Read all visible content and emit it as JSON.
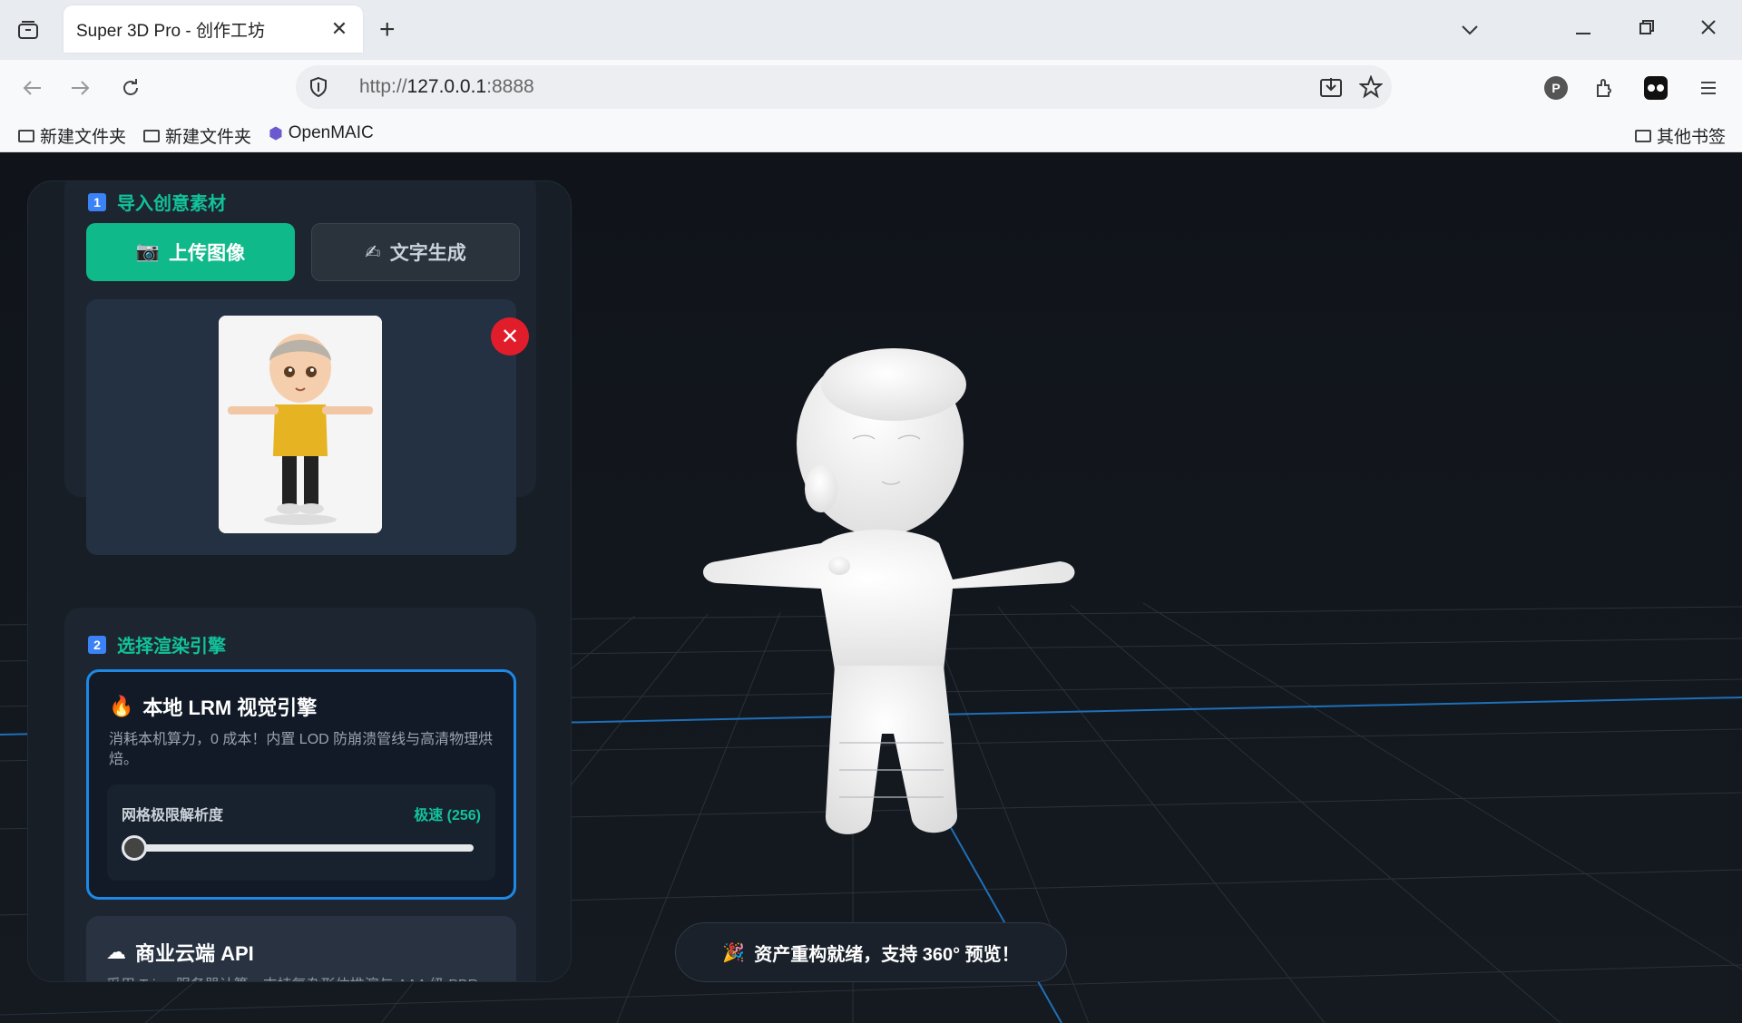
{
  "browser": {
    "tab_title": "Super 3D Pro - 创作工坊",
    "url_prefix": "http://",
    "url_host": "127.0.0.1",
    "url_port": ":8888",
    "bookmarks": [
      "新建文件夹",
      "新建文件夹",
      "OpenMAIC"
    ],
    "other_bookmarks": "其他书签",
    "profile_initial": "P"
  },
  "panel": {
    "section1": {
      "number": "1",
      "title": "导入创意素材",
      "upload_label": "上传图像",
      "upload_icon": "📷",
      "text_gen_label": "文字生成",
      "text_gen_icon": "✍"
    },
    "section2": {
      "number": "2",
      "title": "选择渲染引擎",
      "local_engine": {
        "icon": "🔥",
        "title": "本地 LRM 视觉引擎",
        "description": "消耗本机算力，0 成本！内置 LOD 防崩溃管线与高清物理烘焙。",
        "resolution_label": "网格极限解析度",
        "resolution_value": "极速 (256)",
        "slider_fraction": 0
      },
      "cloud_engine": {
        "icon": "☁",
        "title": "商业云端 API",
        "description": "采用 Tripo 服务器计算，支持复杂形体推演与 AAA 级 PBR"
      }
    }
  },
  "status": {
    "icon": "🎉",
    "message": "资产重构就绪，支持 360° 预览！"
  },
  "colors": {
    "accent": "#10b98a",
    "selected_border": "#1e88e5",
    "danger": "#e11d2b"
  }
}
